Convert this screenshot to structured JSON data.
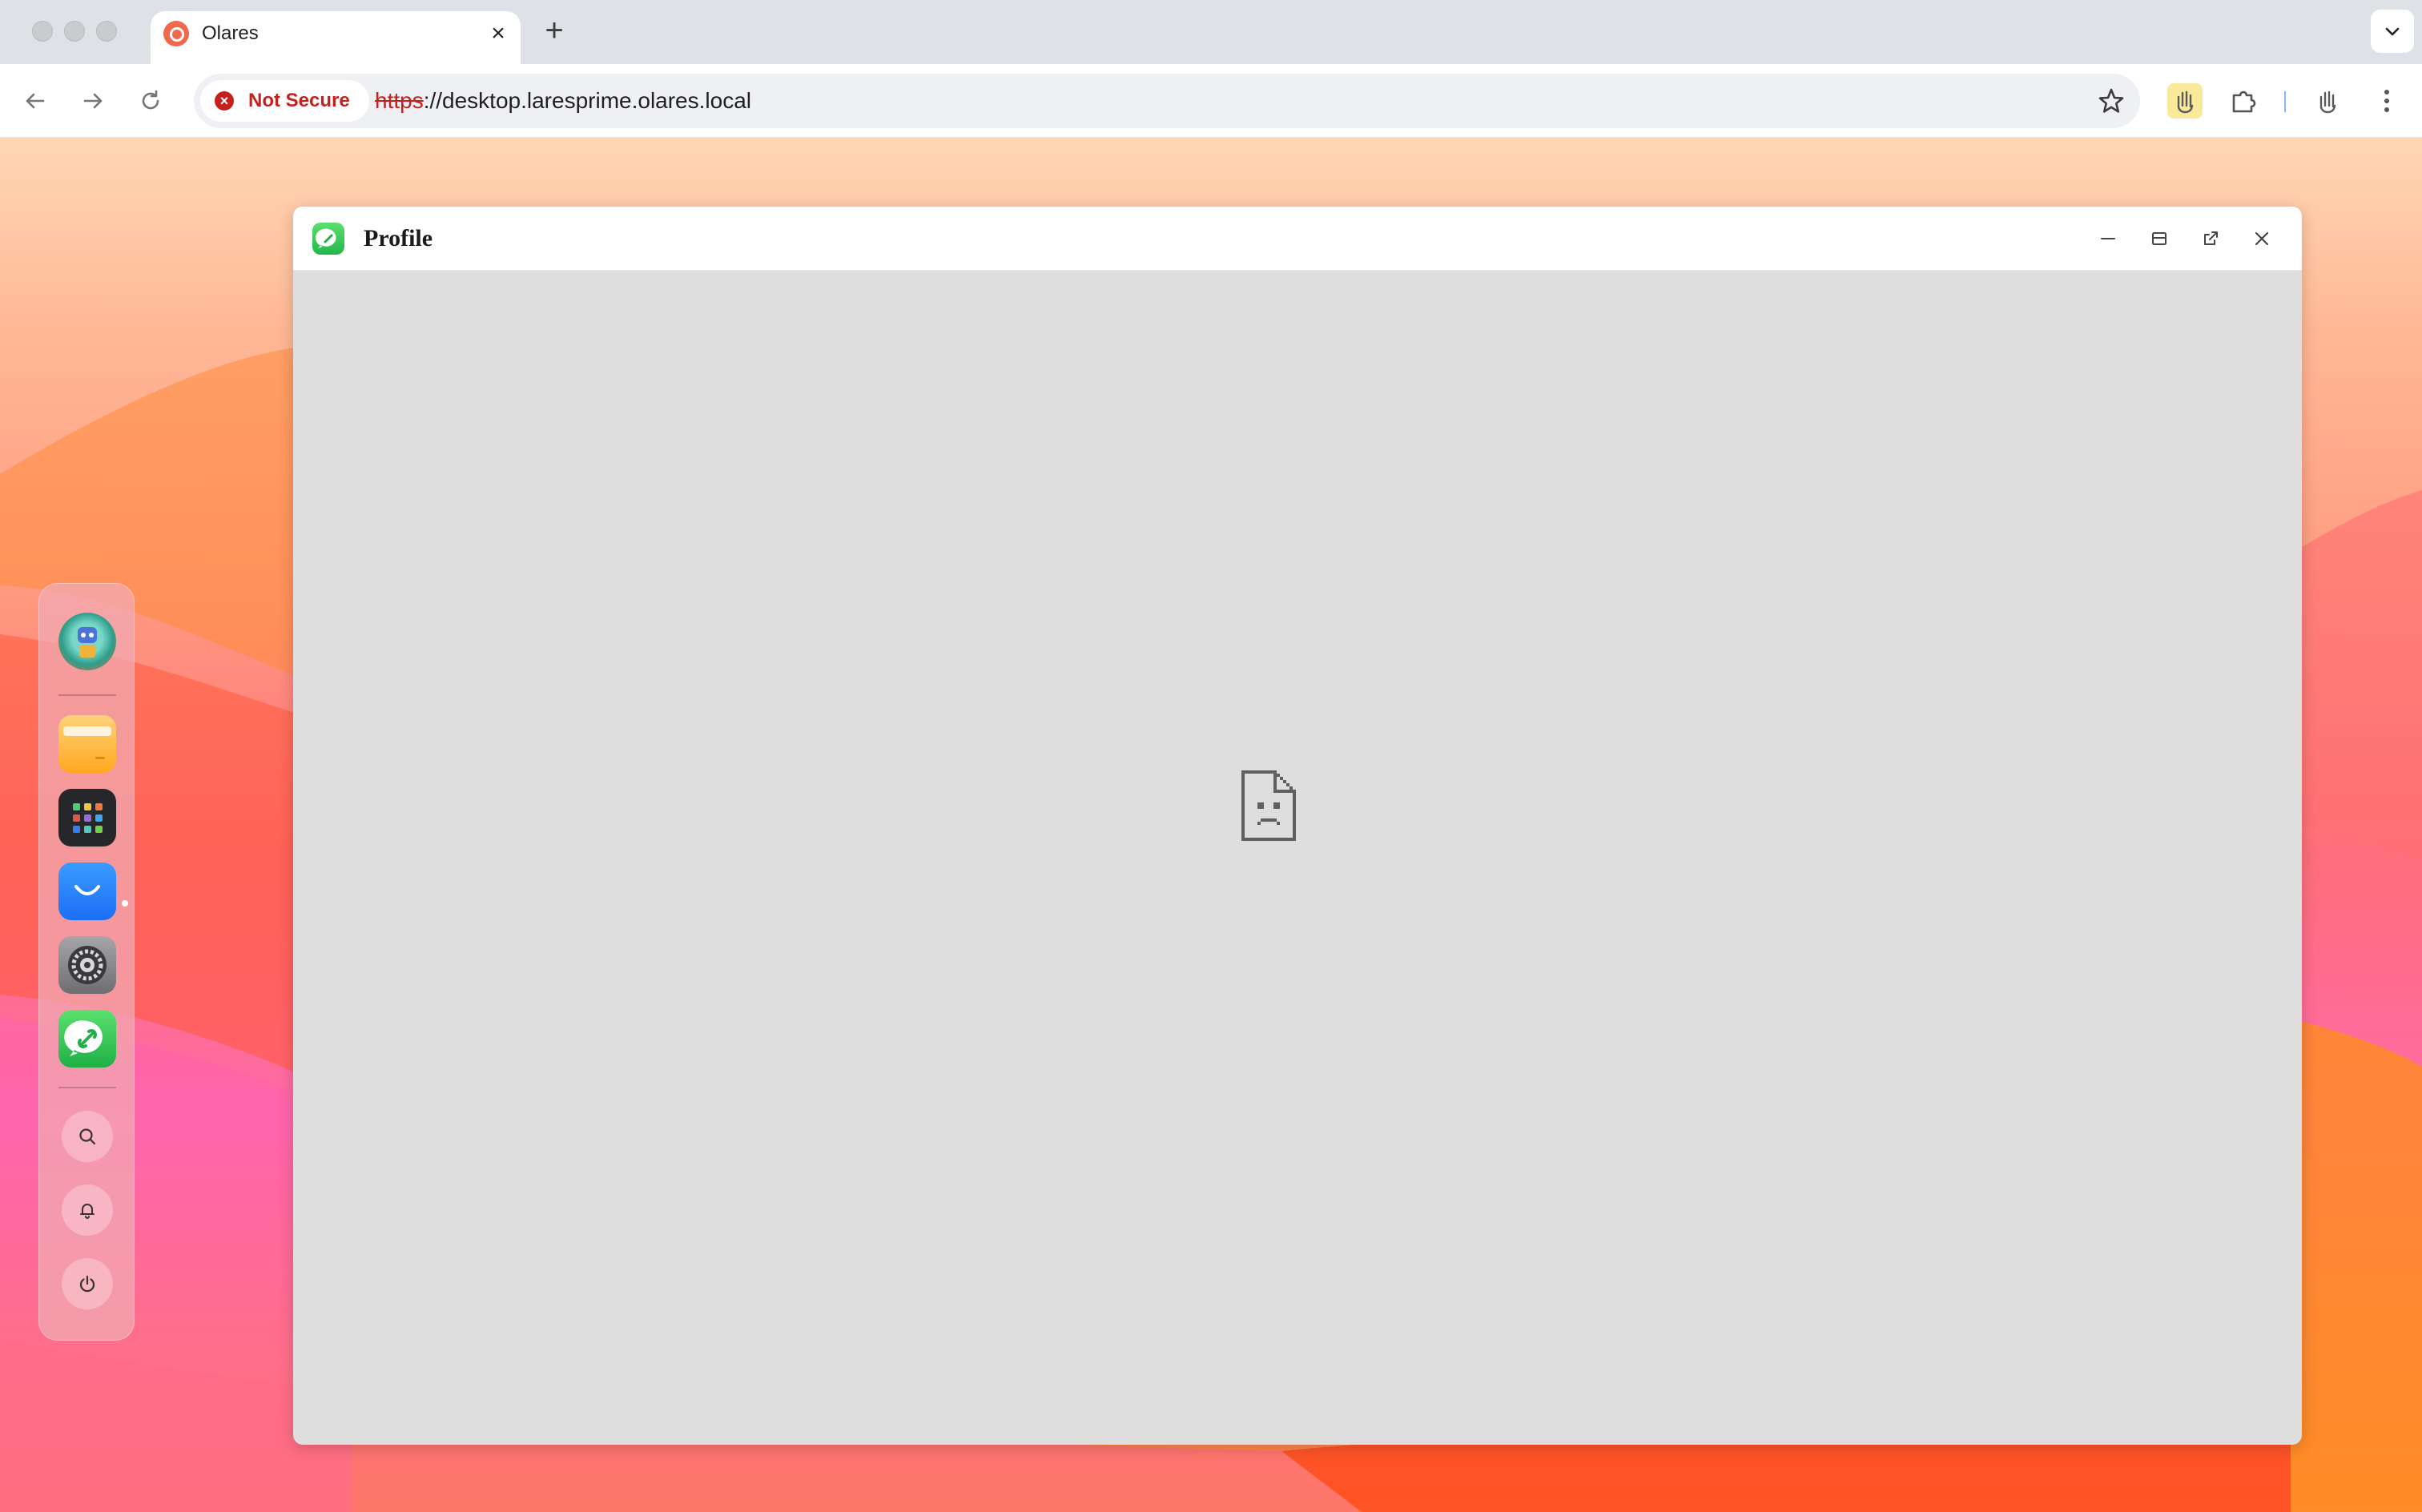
{
  "browser": {
    "tab": {
      "title": "Olares",
      "close_glyph": "×"
    },
    "new_tab_glyph": "+",
    "security": {
      "label": "Not Secure",
      "icon": "x-circle-icon",
      "color": "#c5221f"
    },
    "url": {
      "scheme": "https",
      "rest": "://desktop.laresprime.olares.local"
    }
  },
  "dock": {
    "apps": [
      {
        "name": "avatar",
        "icon": "avatar-icon"
      },
      {
        "name": "Files",
        "icon": "folder-icon"
      },
      {
        "name": "Launchpad",
        "icon": "apps-grid-icon"
      },
      {
        "name": "Market",
        "icon": "market-bag-icon"
      },
      {
        "name": "Settings",
        "icon": "gear-icon"
      },
      {
        "name": "Profile",
        "icon": "profile-link-icon",
        "running": true
      }
    ],
    "actions": [
      {
        "name": "search",
        "icon": "search-icon"
      },
      {
        "name": "notifications",
        "icon": "bell-icon"
      },
      {
        "name": "power",
        "icon": "power-icon"
      }
    ]
  },
  "window": {
    "title": "Profile",
    "controls": [
      "minimize-icon",
      "maximize-icon",
      "open-external-icon",
      "close-icon"
    ],
    "content_state": "broken-page-icon"
  },
  "colors": {
    "window_bg": "#dedede",
    "dock_bg": "#f2aab2",
    "accent_green": "#22b84a"
  }
}
